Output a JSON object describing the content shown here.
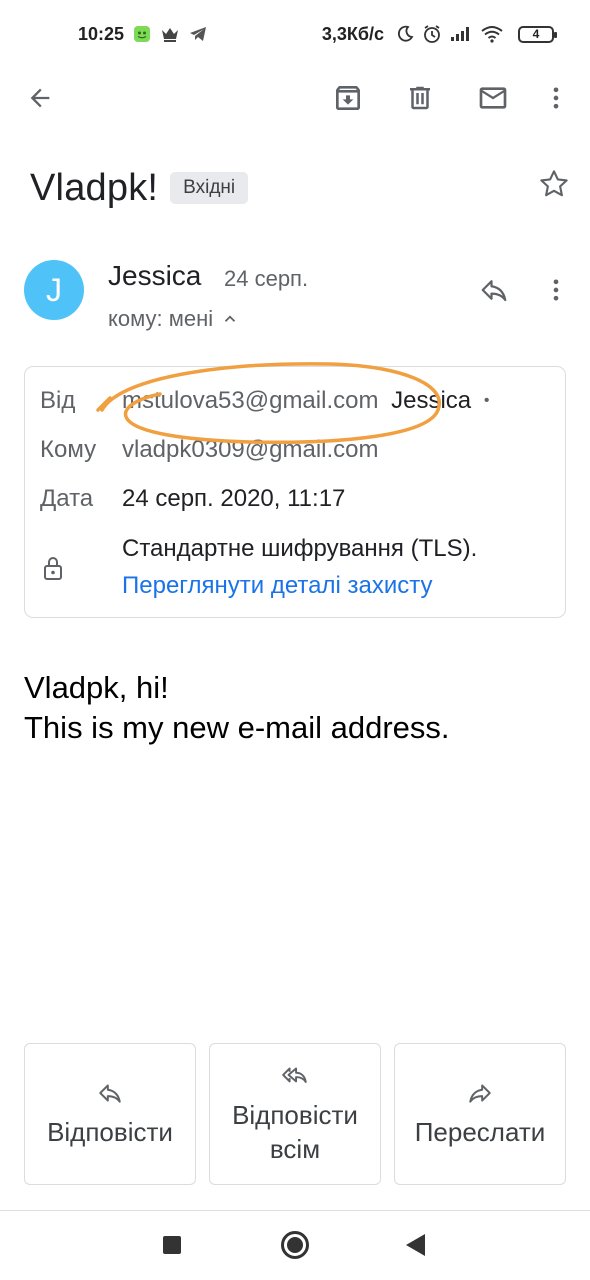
{
  "status_bar": {
    "time": "10:25",
    "speed": "3,3Кб/с",
    "battery": "4"
  },
  "email": {
    "subject": "Vladpk!",
    "label": "Вхідні",
    "sender": {
      "initial": "J",
      "name": "Jessica",
      "date": "24 серп.",
      "recipients_summary": "кому: мені"
    },
    "details": {
      "from_label": "Від",
      "from_email": "mstulova53@gmail.com",
      "from_name": "Jessica",
      "from_dot": "•",
      "to_label": "Кому",
      "to_value": "vladpk0309@gmail.com",
      "date_label": "Дата",
      "date_value": "24 серп. 2020, 11:17",
      "encryption": "Стандартне шифрування (TLS).",
      "security_link": "Переглянути деталі захисту"
    },
    "body_lines": [
      "Vladpk, hi!",
      "This is my new e-mail address."
    ]
  },
  "actions": {
    "reply": "Відповісти",
    "reply_all_line1": "Відповісти",
    "reply_all_line2": "всім",
    "forward": "Переслати"
  },
  "colors": {
    "avatar": "#4fc3f7",
    "link": "#1a73e8",
    "annotation": "#f0a040",
    "chip_bg": "#e8eaed"
  },
  "icons": {
    "back": "arrow-left-icon",
    "archive": "archive-icon",
    "delete": "trash-icon",
    "mark_unread": "mail-icon",
    "more": "more-vert-icon",
    "star": "star-icon",
    "reply": "reply-icon",
    "reply_all": "reply-all-icon",
    "forward": "forward-icon",
    "lock": "lock-icon"
  }
}
